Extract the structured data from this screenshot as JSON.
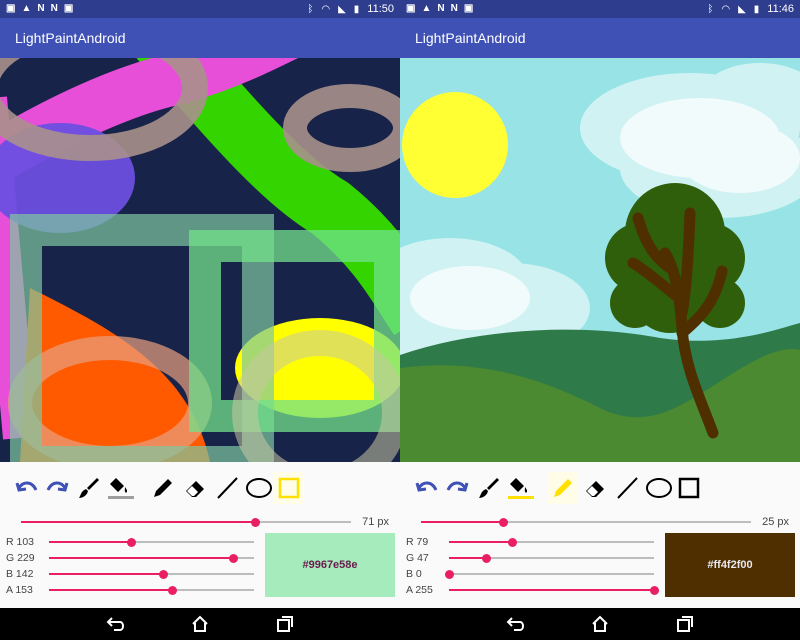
{
  "left": {
    "status": {
      "time": "11:50",
      "notif_icons": [
        "image-icon",
        "warning-icon",
        "n-icon",
        "n-icon",
        "image-icon"
      ]
    },
    "app_title": "LightPaintAndroid",
    "size_label": "71 px",
    "size_value": 71,
    "rgba": [
      {
        "label": "R 103",
        "value": 103
      },
      {
        "label": "G 229",
        "value": 229
      },
      {
        "label": "B 142",
        "value": 142
      },
      {
        "label": "A 153",
        "value": 153
      }
    ],
    "swatch_hex": "#9967e58e",
    "swatch_color": "#a6ebbb",
    "swatch_text_color": "#6a1b4d",
    "active_tool": "rectangle"
  },
  "right": {
    "status": {
      "time": "11:46",
      "notif_icons": [
        "image-icon",
        "warning-icon",
        "n-icon",
        "n-icon",
        "image-icon"
      ]
    },
    "app_title": "LightPaintAndroid",
    "size_label": "25 px",
    "size_value": 25,
    "rgba": [
      {
        "label": "R 79",
        "value": 79
      },
      {
        "label": "G 47",
        "value": 47
      },
      {
        "label": "B 0",
        "value": 0
      },
      {
        "label": "A 255",
        "value": 255
      }
    ],
    "swatch_hex": "#ff4f2f00",
    "swatch_color": "#4f2f00",
    "swatch_text_color": "#e8e8f0",
    "active_tool": "pencil"
  },
  "colors": {
    "appbar": "#3f51b5",
    "statusbar": "#2f3d8f",
    "accent": "#e91e63",
    "undo_blue": "#3f51b5"
  }
}
